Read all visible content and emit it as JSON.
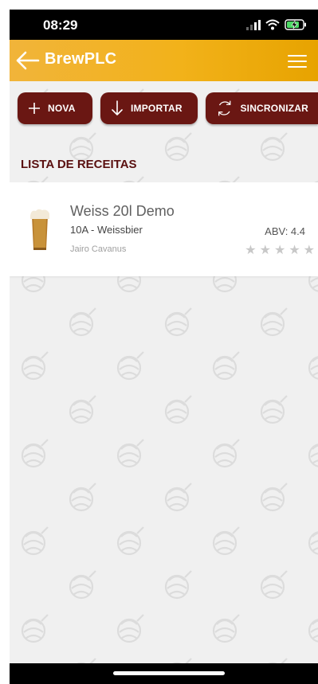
{
  "status": {
    "time": "08:29"
  },
  "appbar": {
    "title": "BrewPLC"
  },
  "actions": {
    "new_label": "NOVA",
    "import_label": "IMPORTAR",
    "sync_label": "SINCRONIZAR"
  },
  "list": {
    "title": "LISTA DE RECEITAS",
    "items": [
      {
        "name": "Weiss 20l Demo",
        "style": "10A - Weissbier",
        "author": "Jairo Cavanus",
        "abv": "ABV: 4.4",
        "stars": [
          "★",
          "★",
          "★",
          "★",
          "★"
        ],
        "rating": 0
      }
    ]
  },
  "colors": {
    "appbar": "#f2b21a",
    "button": "#6a1713",
    "section_title": "#5a1010",
    "background": "#f0f0f0"
  }
}
